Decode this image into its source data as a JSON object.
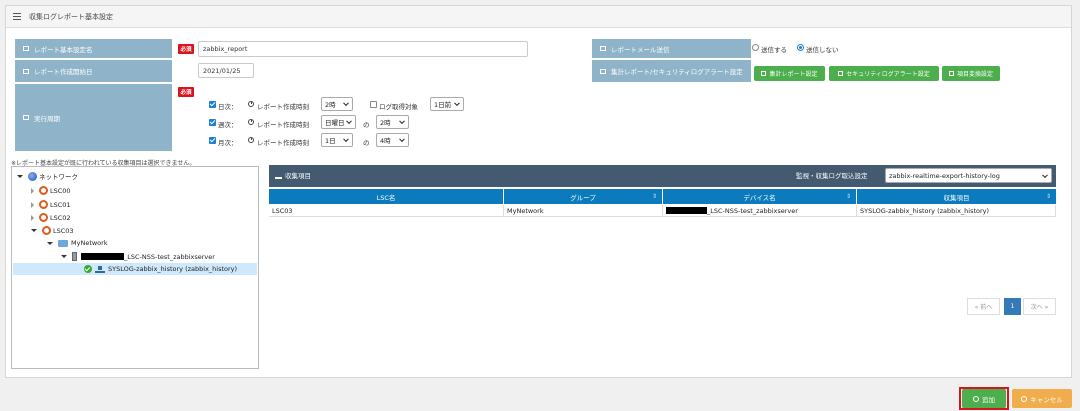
{
  "header": {
    "title": "収集ログレポート基本設定"
  },
  "form": {
    "required_badge": "必須",
    "report_name": {
      "label": "レポート基本設定名",
      "value": "zabbix_report"
    },
    "start_date": {
      "label": "レポート作成開始日",
      "value": "2021/01/25"
    },
    "mail": {
      "label": "レポートメール送信",
      "options": [
        "送信する",
        "送信しない"
      ],
      "selected": "送信しない"
    },
    "aggregate": {
      "label": "集計レポート/セキュリティログアラート設定",
      "buttons": [
        "集計レポート設定",
        "セキュリティログアラート設定",
        "項目変換設定"
      ]
    },
    "cycle": {
      "label": "実行周期",
      "daily": {
        "label": "日次：",
        "checked": true,
        "time_label": "レポート作成時刻",
        "hour": "2時",
        "log_target_label": "ログ取得対象",
        "log_target_checked": false,
        "log_target": "1日前"
      },
      "weekly": {
        "label": "週次：",
        "checked": true,
        "time_label": "レポート作成時刻",
        "weekday": "日曜日",
        "sep": "の",
        "hour": "2時"
      },
      "monthly": {
        "label": "月次：",
        "checked": true,
        "time_label": "レポート作成時刻",
        "day": "1日",
        "sep": "の",
        "hour": "4時"
      }
    }
  },
  "tree": {
    "note": "※レポート基本設定が既に行われている収集項目は選択できません。",
    "nodes": {
      "root": "ネットワーク",
      "lsc00": "LSC00",
      "lsc01": "LSC01",
      "lsc02": "LSC02",
      "lsc03": "LSC03",
      "group": "MyNetwork",
      "device": "_LSC-NSS-test_zabbixserver",
      "item": "SYSLOG-zabbix_history (zabbix_history)"
    }
  },
  "table": {
    "title": "収集項目",
    "filter_label": "監視・収集ログ取込設定",
    "filter_value": "zabbix-realtime-export-history-log",
    "columns": [
      "LSC名",
      "グループ",
      "デバイス名",
      "収集項目"
    ],
    "rows": [
      [
        "LSC03",
        "MyNetwork",
        "_LSC-NSS-test_zabbixserver",
        "SYSLOG-zabbix_history (zabbix_history)"
      ]
    ],
    "pagination": {
      "prev": "« 前へ",
      "current": "1",
      "next": "次へ »"
    }
  },
  "footer": {
    "add": "追加",
    "cancel": "キャンセル"
  }
}
